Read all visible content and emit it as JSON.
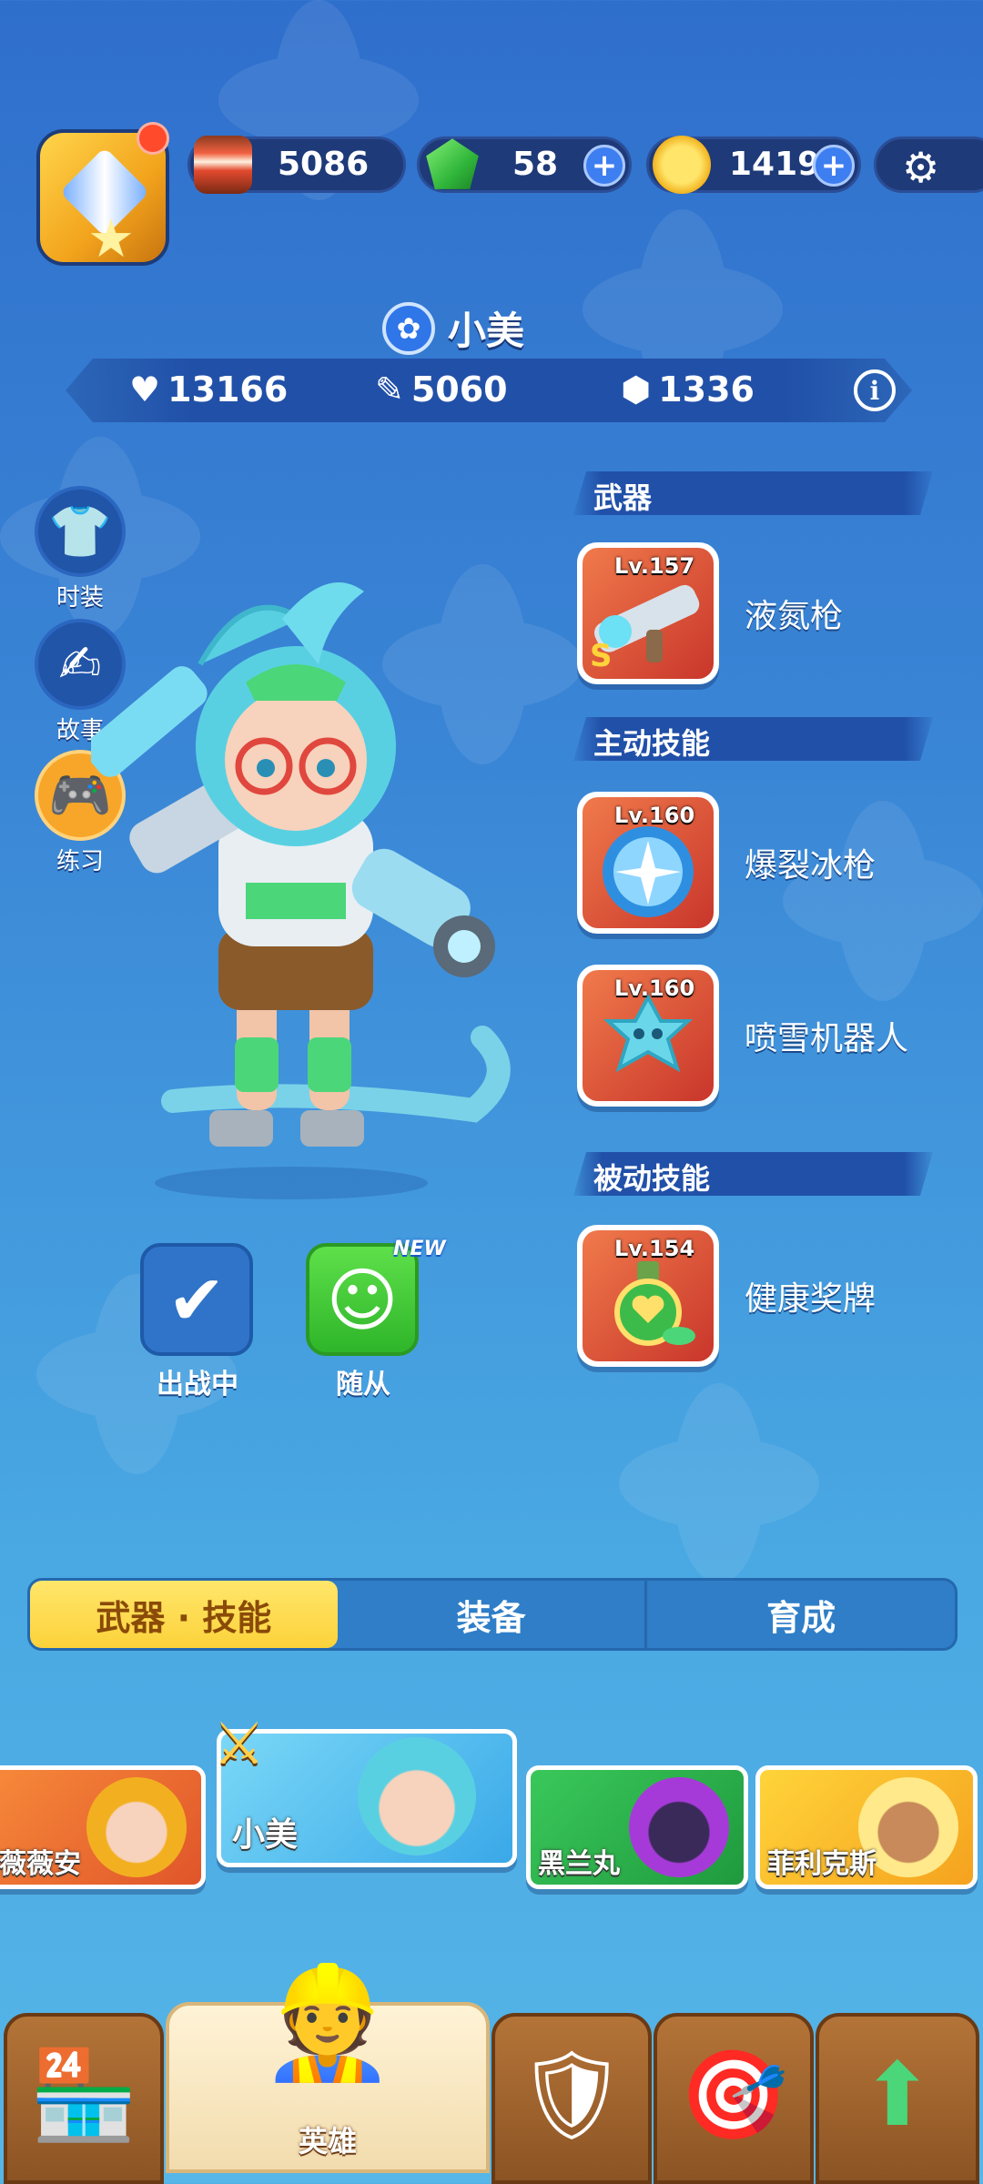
{
  "currencies": [
    {
      "name": "cake",
      "icon": "cake-icon",
      "value": "5086"
    },
    {
      "name": "gem",
      "icon": "gem-icon",
      "value": "58"
    },
    {
      "name": "coin",
      "icon": "coin-icon",
      "value": "1419"
    }
  ],
  "hero": {
    "element_icon": "snowflake-icon",
    "name": "小美",
    "stats": {
      "health": "13166",
      "attack": "5060",
      "defense": "1336"
    }
  },
  "side_menu": [
    {
      "label": "时装",
      "icon": "shirt-icon"
    },
    {
      "label": "故事",
      "icon": "story-book-icon"
    },
    {
      "label": "练习",
      "icon": "gamepad-icon"
    }
  ],
  "sections": {
    "weapon": "武器",
    "active": "主动技能",
    "passive": "被动技能"
  },
  "skills": [
    {
      "level": "Lv.157",
      "name": "液氮枪",
      "icon": "liquid-nitrogen-gun-icon"
    },
    {
      "level": "Lv.160",
      "name": "爆裂冰枪",
      "icon": "ice-burst-icon"
    },
    {
      "level": "Lv.160",
      "name": "喷雪机器人",
      "icon": "snow-robot-icon"
    },
    {
      "level": "Lv.154",
      "name": "健康奖牌",
      "icon": "health-medal-icon"
    }
  ],
  "status": {
    "deployed": "出战中",
    "companion": "随从",
    "new_badge": "NEW"
  },
  "tabs": [
    {
      "label": "武器 · 技能",
      "active": true
    },
    {
      "label": "装备",
      "active": false
    },
    {
      "label": "育成",
      "active": false
    }
  ],
  "heroes": [
    {
      "name": "薇薇安",
      "bg": "#f0682f"
    },
    {
      "name": "小美",
      "bg": "#5cc8f5"
    },
    {
      "name": "黑兰丸",
      "bg": "#28b04e"
    },
    {
      "name": "菲利克斯",
      "bg": "#f7b81e"
    }
  ],
  "bottom_nav": [
    {
      "icon": "shop-icon",
      "label": ""
    },
    {
      "icon": "hero-icon",
      "label": "英雄"
    },
    {
      "icon": "battle-shield-icon",
      "label": ""
    },
    {
      "icon": "target-icon",
      "label": ""
    },
    {
      "icon": "upgrade-arrow-icon",
      "label": ""
    }
  ]
}
